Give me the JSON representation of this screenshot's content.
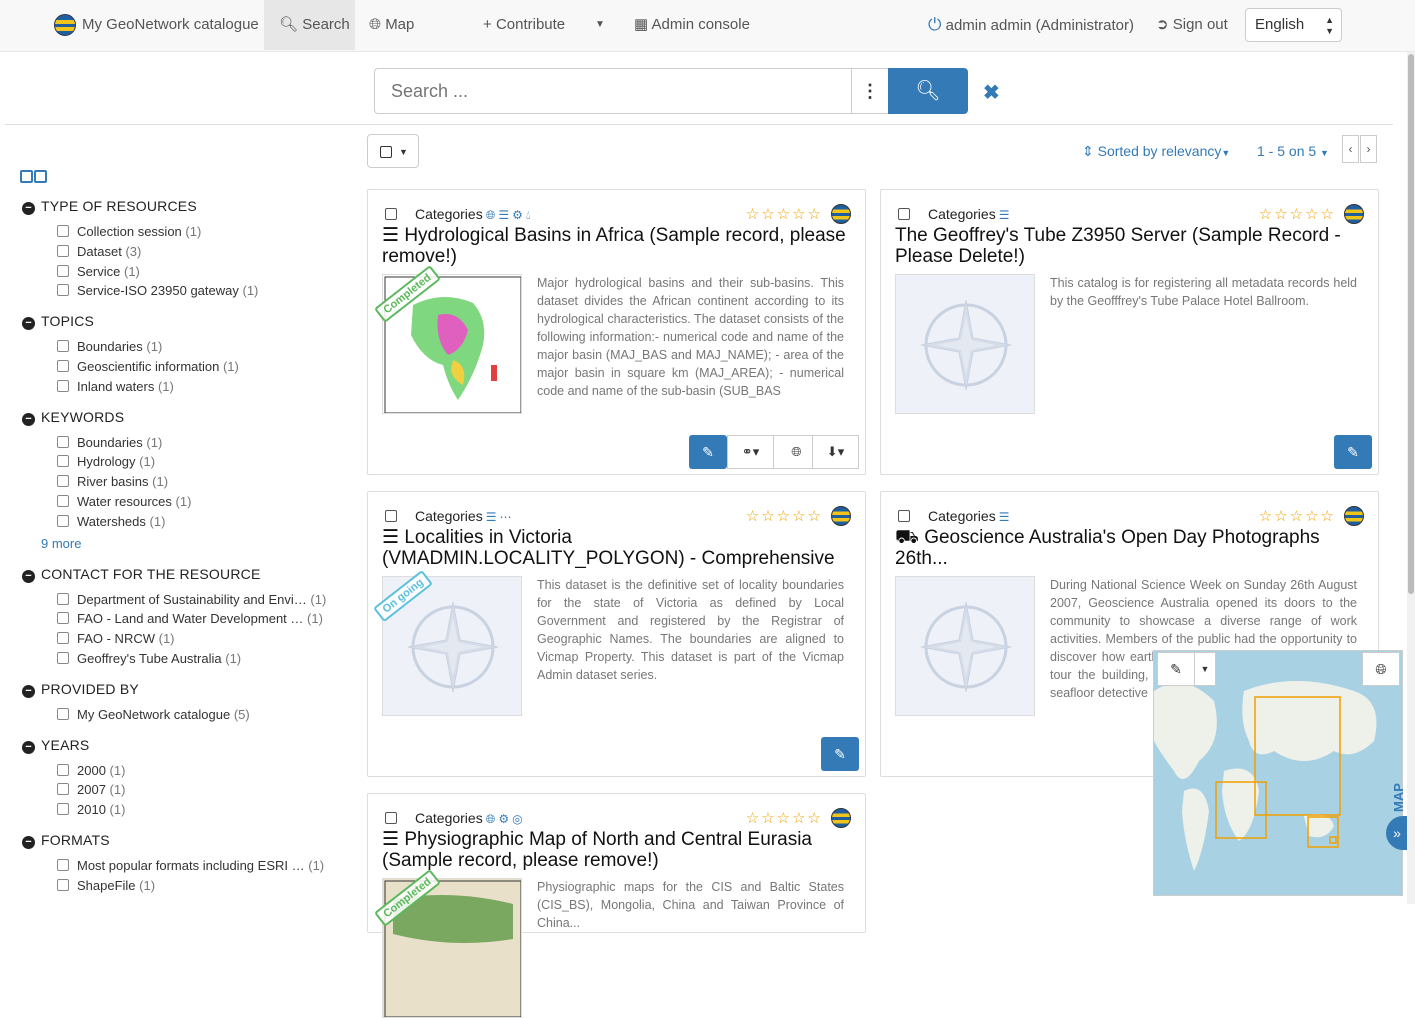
{
  "header": {
    "brand": "My GeoNetwork catalogue",
    "nav": [
      {
        "label": "Search",
        "active": true
      },
      {
        "label": "Map"
      },
      {
        "label": "Contribute"
      },
      {
        "label": "Admin console"
      }
    ],
    "user": "admin admin (Administrator)",
    "sign_out": "Sign out",
    "language": "English"
  },
  "search": {
    "placeholder": "Search ..."
  },
  "facets": {
    "groups": [
      {
        "title": "TYPE OF RESOURCES",
        "items": [
          {
            "label": "Collection session",
            "count": "(1)"
          },
          {
            "label": "Dataset",
            "count": "(3)"
          },
          {
            "label": "Service",
            "count": "(1)"
          },
          {
            "label": "Service-ISO 23950 gateway",
            "count": "(1)"
          }
        ]
      },
      {
        "title": "TOPICS",
        "items": [
          {
            "label": "Boundaries",
            "count": "(1)"
          },
          {
            "label": "Geoscientific information",
            "count": "(1)"
          },
          {
            "label": "Inland waters",
            "count": "(1)"
          }
        ]
      },
      {
        "title": "KEYWORDS",
        "items": [
          {
            "label": "Boundaries",
            "count": "(1)"
          },
          {
            "label": "Hydrology",
            "count": "(1)"
          },
          {
            "label": "River basins",
            "count": "(1)"
          },
          {
            "label": "Water resources",
            "count": "(1)"
          },
          {
            "label": "Watersheds",
            "count": "(1)"
          }
        ],
        "more": "9  more"
      },
      {
        "title": "CONTACT FOR THE RESOURCE",
        "items": [
          {
            "label": "Department of Sustainability and Envi…",
            "count": "(1)"
          },
          {
            "label": "FAO - Land and Water Development …",
            "count": "(1)"
          },
          {
            "label": "FAO - NRCW",
            "count": "(1)"
          },
          {
            "label": "Geoffrey's Tube Australia",
            "count": "(1)"
          }
        ]
      },
      {
        "title": "PROVIDED BY",
        "items": [
          {
            "label": "My GeoNetwork catalogue",
            "count": "(5)"
          }
        ]
      },
      {
        "title": "YEARS",
        "items": [
          {
            "label": "2000",
            "count": "(1)"
          },
          {
            "label": "2007",
            "count": "(1)"
          },
          {
            "label": "2010",
            "count": "(1)"
          }
        ]
      },
      {
        "title": "FORMATS",
        "items": [
          {
            "label": "Most popular formats including ESRI …",
            "count": "(1)"
          },
          {
            "label": "ShapeFile",
            "count": "(1)"
          }
        ]
      }
    ]
  },
  "results": {
    "sort": "Sorted by relevancy",
    "pager": "1 - 5 on 5",
    "cards": [
      {
        "category_label": "Categories",
        "title": "Hydrological Basins in Africa (Sample record, please remove!)",
        "status": "Completed",
        "abstract": "Major hydrological basins and their sub-basins. This dataset divides the African continent according to its hydrological characteristics. The dataset consists of the following information:- numerical code and name of the major basin (MAJ_BAS and MAJ_NAME); - area of the major basin in square km (MAJ_AREA); - numerical code and name of the sub-basin (SUB_BAS"
      },
      {
        "category_label": "Categories",
        "title": "The Geoffrey's Tube Z3950 Server (Sample Record - Please Delete!)",
        "abstract": "This catalog is for registering all metadata records held by the Geofffrey's Tube Palace Hotel Ballroom."
      },
      {
        "category_label": "Categories",
        "title": "Localities in Victoria (VMADMIN.LOCALITY_POLYGON) - Comprehensive Elements",
        "status": "On going",
        "abstract": "This dataset is the definitive set of locality boundaries for the state of Victoria as defined by Local Government and registered by the Registrar of Geographic Names. The boundaries are aligned to Vicmap Property. This dataset is part of the Vicmap Admin dataset series."
      },
      {
        "category_label": "Categories",
        "title": "Geoscience Australia's Open Day Photographs 26th...",
        "abstract": "During National Science Week on Sunday 26th August 2007, Geoscience Australia opened its doors to the community to showcase a diverse range of work activities. Members of the public had the opportunity to discover how earthquakes are detected, pan for gold, tour the building, explore Australia in 3D, become a seafloor detective"
      },
      {
        "category_label": "Categories",
        "title": "Physiographic Map of North and Central Eurasia (Sample record, please remove!)",
        "status": "Completed",
        "abstract": "Physiographic maps for the CIS and Baltic States (CIS_BS), Mongolia, China and Taiwan Province of China..."
      }
    ]
  },
  "minimap": {
    "label": "MAP"
  },
  "colors": {
    "accent": "#337ab7",
    "star": "#f0a000",
    "completed": "#5cb85c",
    "ongoing": "#5bc0de"
  }
}
